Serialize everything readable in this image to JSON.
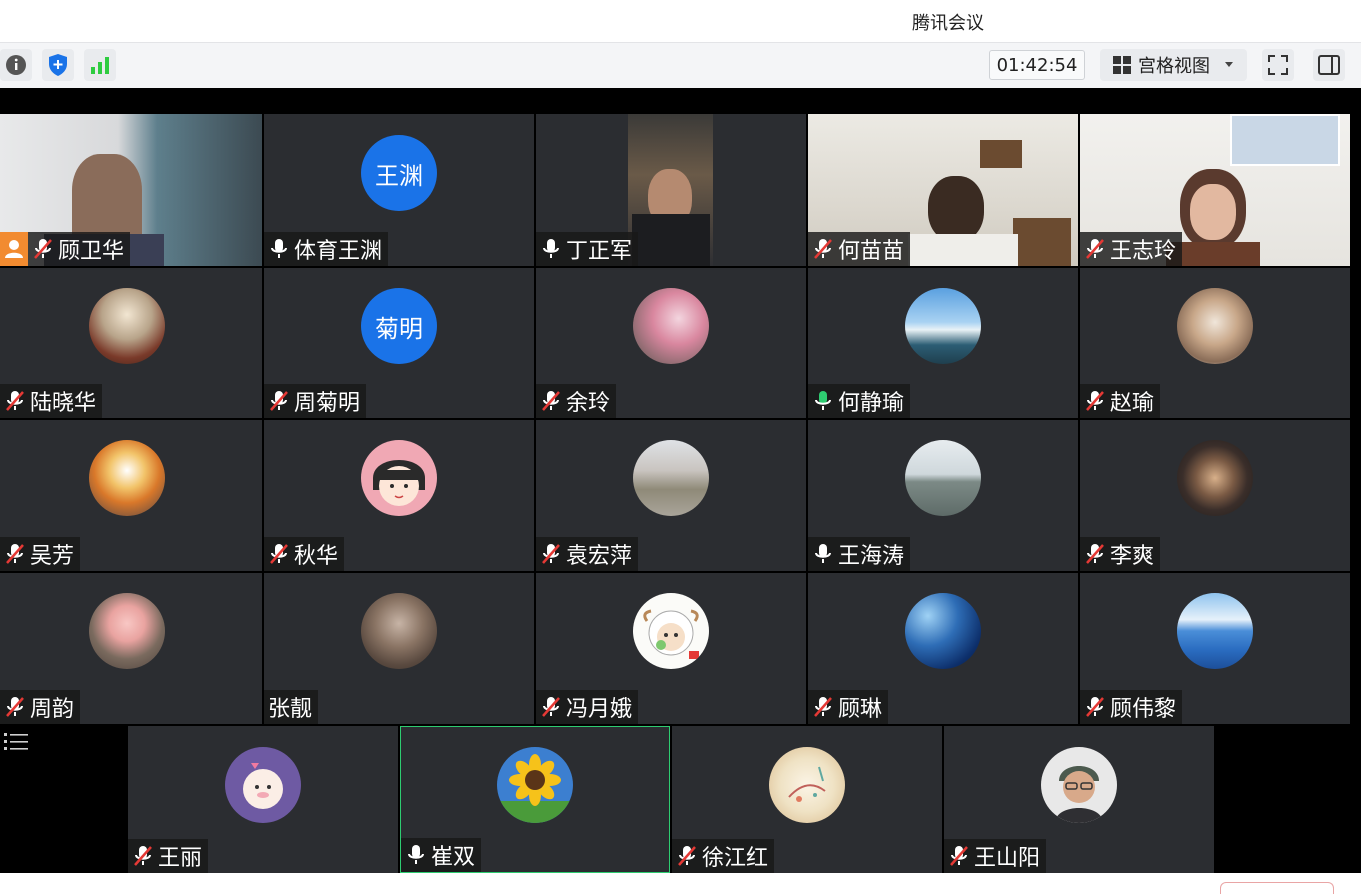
{
  "window": {
    "title": "腾讯会议"
  },
  "toolbar": {
    "timer": "01:42:54",
    "view_label": "宫格视图",
    "icons": [
      "info-icon",
      "shield-icon",
      "signal-icon",
      "grid-view-icon",
      "caret-down-icon",
      "fullscreen-icon",
      "sidebar-toggle-icon"
    ]
  },
  "colors": {
    "accent_blue": "#1a73e8",
    "tile_bg": "#2b2d31",
    "speaking_green": "#2ecc71",
    "host_orange": "#f28b30"
  },
  "participants": [
    {
      "name": "顾卫华",
      "mic": "muted",
      "video": true,
      "host": true
    },
    {
      "name": "体育王渊",
      "mic": "on",
      "avatar_text": "王渊"
    },
    {
      "name": "丁正军",
      "mic": "on",
      "video": true
    },
    {
      "name": "何苗苗",
      "mic": "muted",
      "video": true
    },
    {
      "name": "王志玲",
      "mic": "muted",
      "video": true
    },
    {
      "name": "陆晓华",
      "mic": "muted",
      "avatar": "field-photo"
    },
    {
      "name": "周菊明",
      "mic": "muted",
      "avatar_text": "菊明"
    },
    {
      "name": "余玲",
      "mic": "muted",
      "avatar": "blossom-photo"
    },
    {
      "name": "何静瑜",
      "mic": "speaking",
      "avatar": "waterfall-photo"
    },
    {
      "name": "赵瑜",
      "mic": "muted",
      "avatar": "kitten-photo"
    },
    {
      "name": "吴芳",
      "mic": "muted",
      "avatar": "balloon-photo"
    },
    {
      "name": "秋华",
      "mic": "muted",
      "avatar": "cartoon-girl"
    },
    {
      "name": "袁宏萍",
      "mic": "muted",
      "avatar": "lake-blossom-photo"
    },
    {
      "name": "王海涛",
      "mic": "on",
      "avatar": "lake-photo"
    },
    {
      "name": "李爽",
      "mic": "muted",
      "avatar": "child-photo"
    },
    {
      "name": "周韵",
      "mic": "muted",
      "avatar": "pig-toy"
    },
    {
      "name": "张靓",
      "mic": "none",
      "avatar": "toddler-photo"
    },
    {
      "name": "冯月娥",
      "mic": "muted",
      "avatar": "sheep-cartoon"
    },
    {
      "name": "顾琳",
      "mic": "muted",
      "avatar": "earth-photo"
    },
    {
      "name": "顾伟黎",
      "mic": "muted",
      "avatar": "mountain-lake-photo"
    },
    {
      "name": "王丽",
      "mic": "muted",
      "avatar": "sheep-sticker"
    },
    {
      "name": "崔双",
      "mic": "on",
      "avatar": "sunflower-photo",
      "active": true
    },
    {
      "name": "徐江红",
      "mic": "muted",
      "avatar": "art-illustration"
    },
    {
      "name": "王山阳",
      "mic": "muted",
      "avatar": "3d-avatar"
    }
  ]
}
